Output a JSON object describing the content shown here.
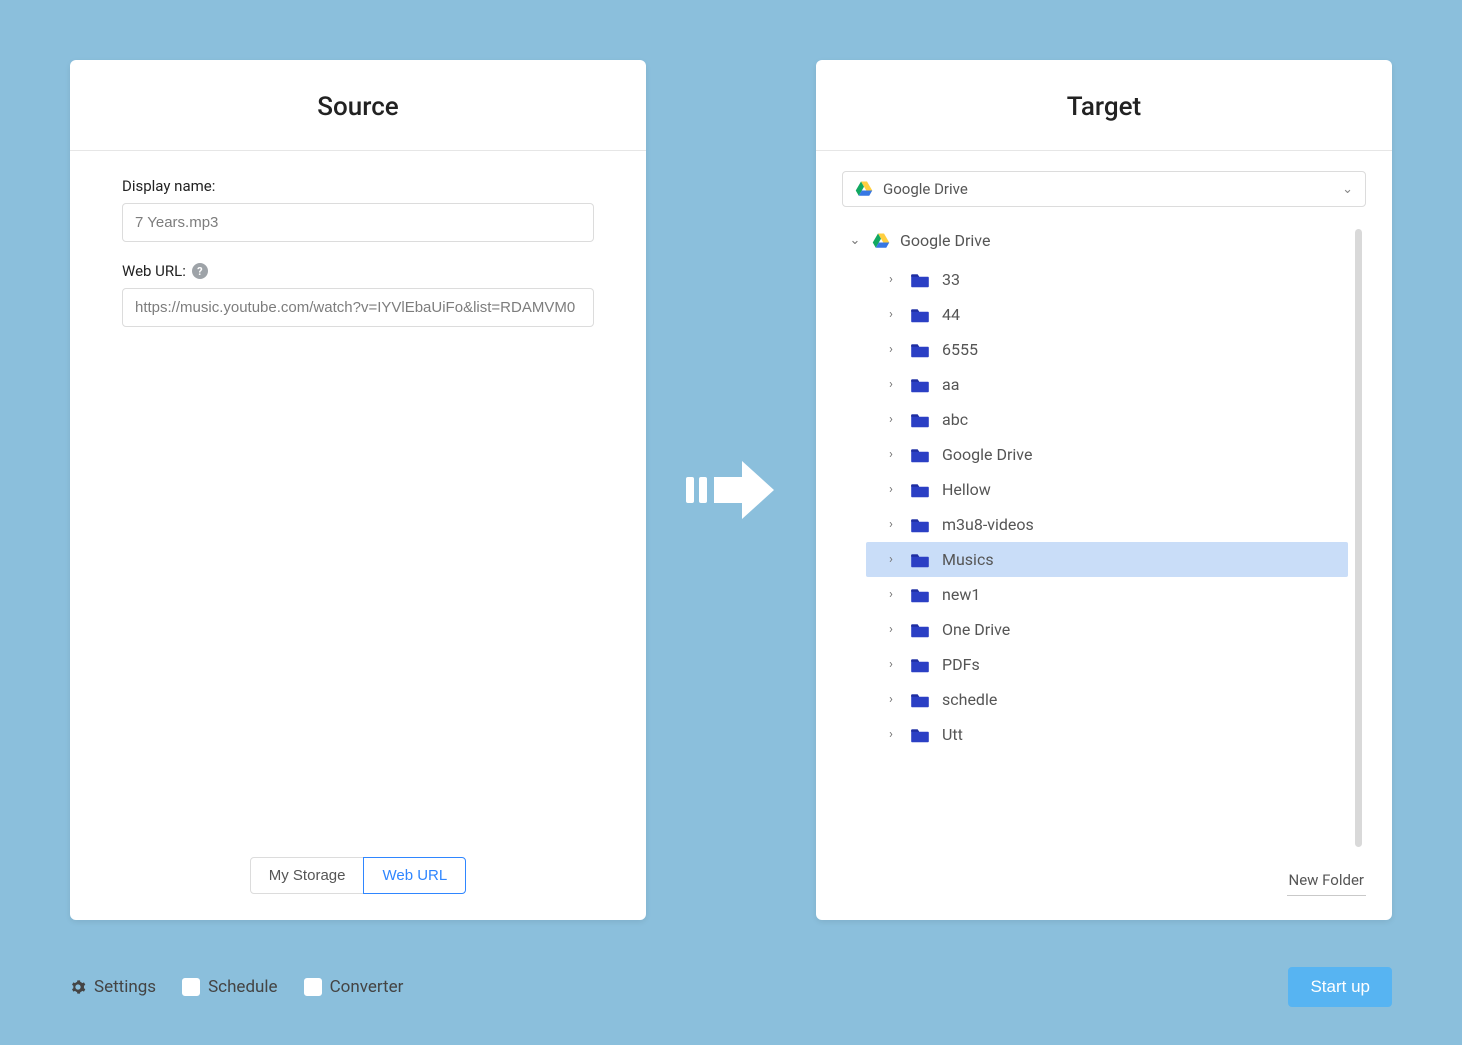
{
  "source": {
    "title": "Source",
    "displayNameLabel": "Display name:",
    "displayNameValue": "7 Years.mp3",
    "webUrlLabel": "Web URL:",
    "webUrlValue": "https://music.youtube.com/watch?v=IYVlEbaUiFo&list=RDAMVM0",
    "tabs": {
      "myStorage": "My Storage",
      "webUrl": "Web URL"
    },
    "activeTab": "webUrl"
  },
  "target": {
    "title": "Target",
    "selectedDrive": "Google Drive",
    "rootLabel": "Google Drive",
    "folders": [
      {
        "name": "33",
        "selected": false
      },
      {
        "name": "44",
        "selected": false
      },
      {
        "name": "6555",
        "selected": false
      },
      {
        "name": "aa",
        "selected": false
      },
      {
        "name": "abc",
        "selected": false
      },
      {
        "name": "Google Drive",
        "selected": false
      },
      {
        "name": "Hellow",
        "selected": false
      },
      {
        "name": "m3u8-videos",
        "selected": false
      },
      {
        "name": "Musics",
        "selected": true
      },
      {
        "name": "new1",
        "selected": false
      },
      {
        "name": "One Drive",
        "selected": false
      },
      {
        "name": "PDFs",
        "selected": false
      },
      {
        "name": "schedle",
        "selected": false
      },
      {
        "name": "Utt",
        "selected": false
      }
    ],
    "newFolderLabel": "New Folder"
  },
  "footer": {
    "settings": "Settings",
    "schedule": "Schedule",
    "converter": "Converter",
    "startUp": "Start up"
  }
}
